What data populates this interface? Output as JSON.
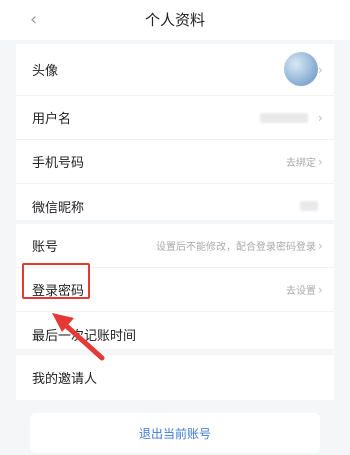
{
  "header": {
    "title": "个人资料",
    "back_glyph": "‹"
  },
  "rows": [
    {
      "label": "头像",
      "value": ""
    },
    {
      "label": "用户名",
      "value": ""
    },
    {
      "label": "手机号码",
      "value": "去绑定"
    },
    {
      "label": "微信昵称",
      "value": ""
    },
    {
      "label": "账号",
      "value": "设置后不能修改，配合登录密码登录"
    },
    {
      "label": "登录密码",
      "value": "去设置"
    },
    {
      "label": "最后一次记账时间",
      "value": ""
    },
    {
      "label": "我的邀请人",
      "value": ""
    }
  ],
  "footer": {
    "logout_label": "退出当前账号"
  },
  "icons": {
    "chevron": "›"
  },
  "colors": {
    "highlight": "#e53935",
    "link": "#3d7bd9"
  }
}
